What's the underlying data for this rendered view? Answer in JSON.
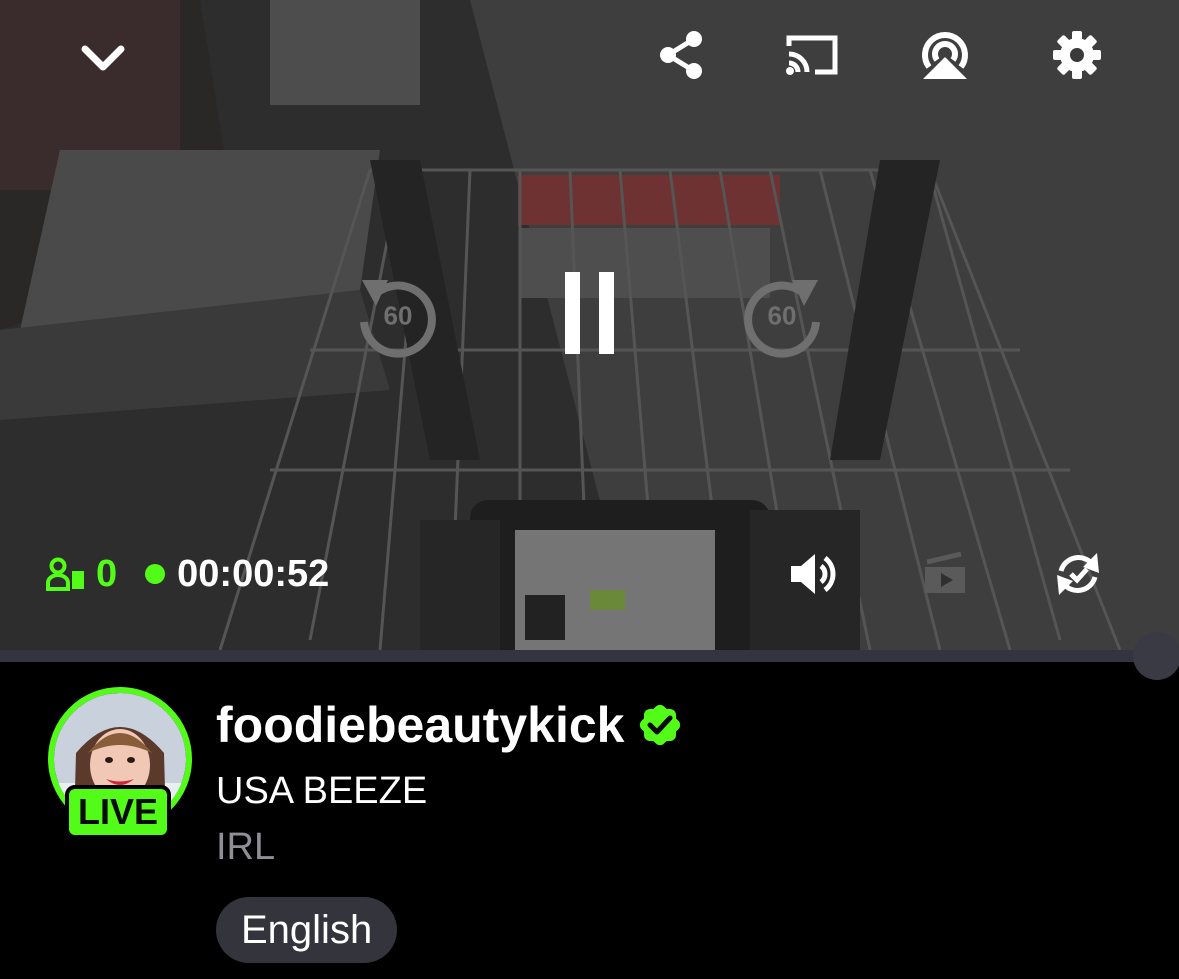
{
  "player": {
    "icons": {
      "collapse": "chevron-down-icon",
      "share": "share-icon",
      "cast": "cast-icon",
      "airplay": "airplay-icon",
      "settings": "gear-icon",
      "rewind": "rewind-60-icon",
      "pause": "pause-icon",
      "forward": "forward-60-icon",
      "volume": "volume-icon",
      "pip": "picture-in-picture-icon",
      "rotate": "rotate-icon",
      "viewers": "viewers-icon"
    },
    "rewind_label": "60",
    "forward_label": "60",
    "viewers_count": "0",
    "elapsed_time": "00:00:52",
    "progress": 1.0
  },
  "channel": {
    "name": "foodiebeautykick",
    "verified": true,
    "live_badge": "LIVE",
    "stream_title": "USA BEEZE",
    "category": "IRL",
    "language": "English"
  },
  "colors": {
    "accent": "#53fc18",
    "background": "#000000",
    "chip": "#34343d",
    "muted_text": "#8f8f95"
  }
}
